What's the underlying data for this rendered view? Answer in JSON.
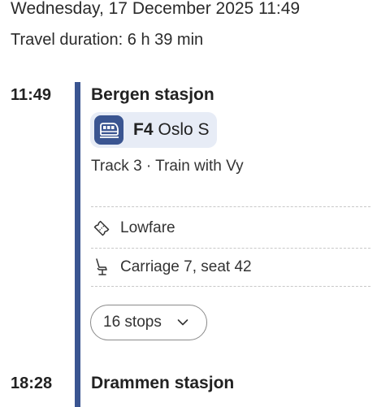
{
  "header": {
    "date_time": "Wednesday, 17 December 2025 11:49",
    "duration": "Travel duration: 6 h 39 min"
  },
  "leg": {
    "departure": {
      "time": "11:49",
      "station": "Bergen stasjon"
    },
    "line": {
      "code": "F4",
      "destination": "Oslo S",
      "icon": "train-icon"
    },
    "track_info": "Track 3 · Train with Vy",
    "details": [
      {
        "icon": "ticket-icon",
        "label": "Lowfare"
      },
      {
        "icon": "seat-icon",
        "label": "Carriage 7, seat 42"
      }
    ],
    "stops_button": {
      "label": "16 stops",
      "icon": "chevron-down-icon"
    },
    "arrival": {
      "time": "18:28",
      "station": "Drammen stasjon"
    }
  },
  "colors": {
    "route_line": "#3a5591",
    "chip_background": "#e7ecf6",
    "divider": "#c8c8c8"
  }
}
